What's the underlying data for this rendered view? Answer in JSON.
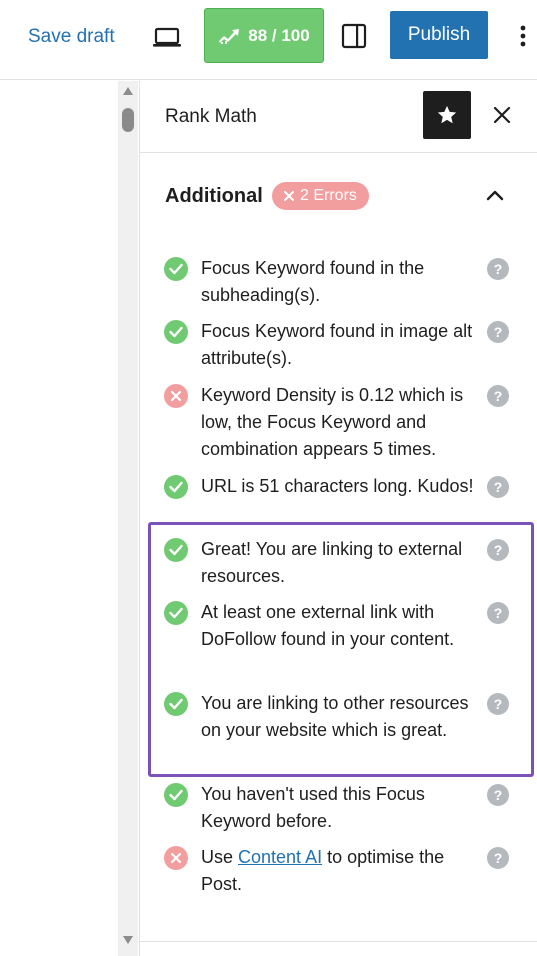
{
  "toolbar": {
    "save_draft_label": "Save draft",
    "score_label": "88 / 100",
    "publish_label": "Publish"
  },
  "panel": {
    "title": "Rank Math",
    "section_title": "Additional",
    "errors_badge": "2 Errors"
  },
  "checks": [
    {
      "status": "ok",
      "text": "Focus Keyword found in the subheading(s)."
    },
    {
      "status": "ok",
      "text": "Focus Keyword found in image alt attribute(s)."
    },
    {
      "status": "error",
      "text": "Keyword Density is 0.12 which is low, the Focus Keyword and combination appears 5 times."
    },
    {
      "status": "ok",
      "text": "URL is 51 characters long. Kudos!"
    },
    {
      "status": "ok",
      "text": "Great! You are linking to external resources."
    },
    {
      "status": "ok",
      "text": "At least one external link with DoFollow found in your content."
    },
    {
      "status": "ok",
      "text": "You are linking to other resources on your website which is great."
    },
    {
      "status": "ok",
      "text": "You haven't used this Focus Keyword before."
    },
    {
      "status": "error",
      "text_before": "Use ",
      "link": "Content AI",
      "text_after": " to optimise the Post."
    }
  ],
  "help_glyph": "?",
  "colors": {
    "accent": "#2271b1",
    "score_green": "#6fca72",
    "error_pink": "#f29e9e",
    "highlight_purple": "#7b52b8"
  }
}
